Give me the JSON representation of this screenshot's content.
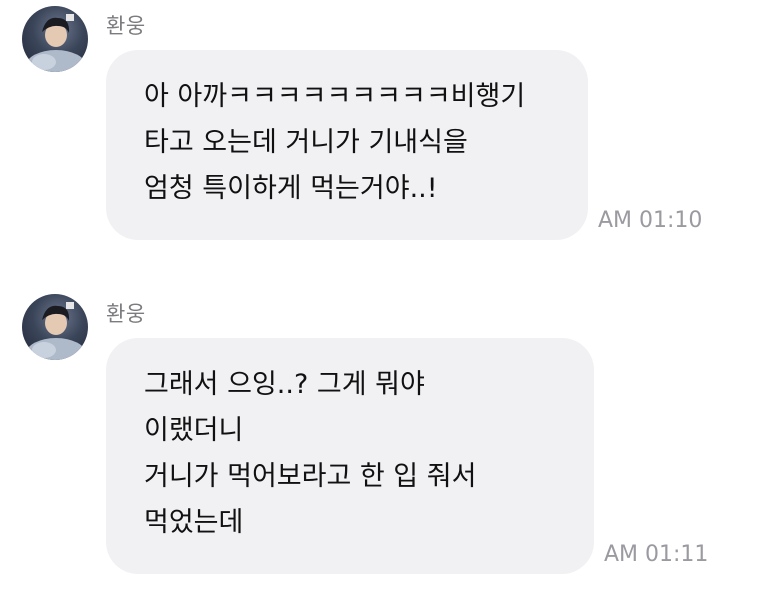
{
  "messages": [
    {
      "sender": "환웅",
      "avatar_icon": "profile-photo",
      "lines": [
        "아 아까ㅋㅋㅋㅋㅋㅋㅋㅋㅋ비행기",
        "타고 오는데 거니가 기내식을",
        "엄청 특이하게 먹는거야..!"
      ],
      "time": "AM 01:10"
    },
    {
      "sender": "환웅",
      "avatar_icon": "profile-photo",
      "lines": [
        "그래서 으잉..? 그게 뭐야",
        "이랬더니",
        "거니가 먹어보라고 한 입 줘서",
        "먹었는데"
      ],
      "time": "AM 01:11"
    }
  ],
  "colors": {
    "bubble": "#f1f1f4",
    "sender": "#7c7c80",
    "time": "#9a9aa0",
    "text": "#111111"
  }
}
